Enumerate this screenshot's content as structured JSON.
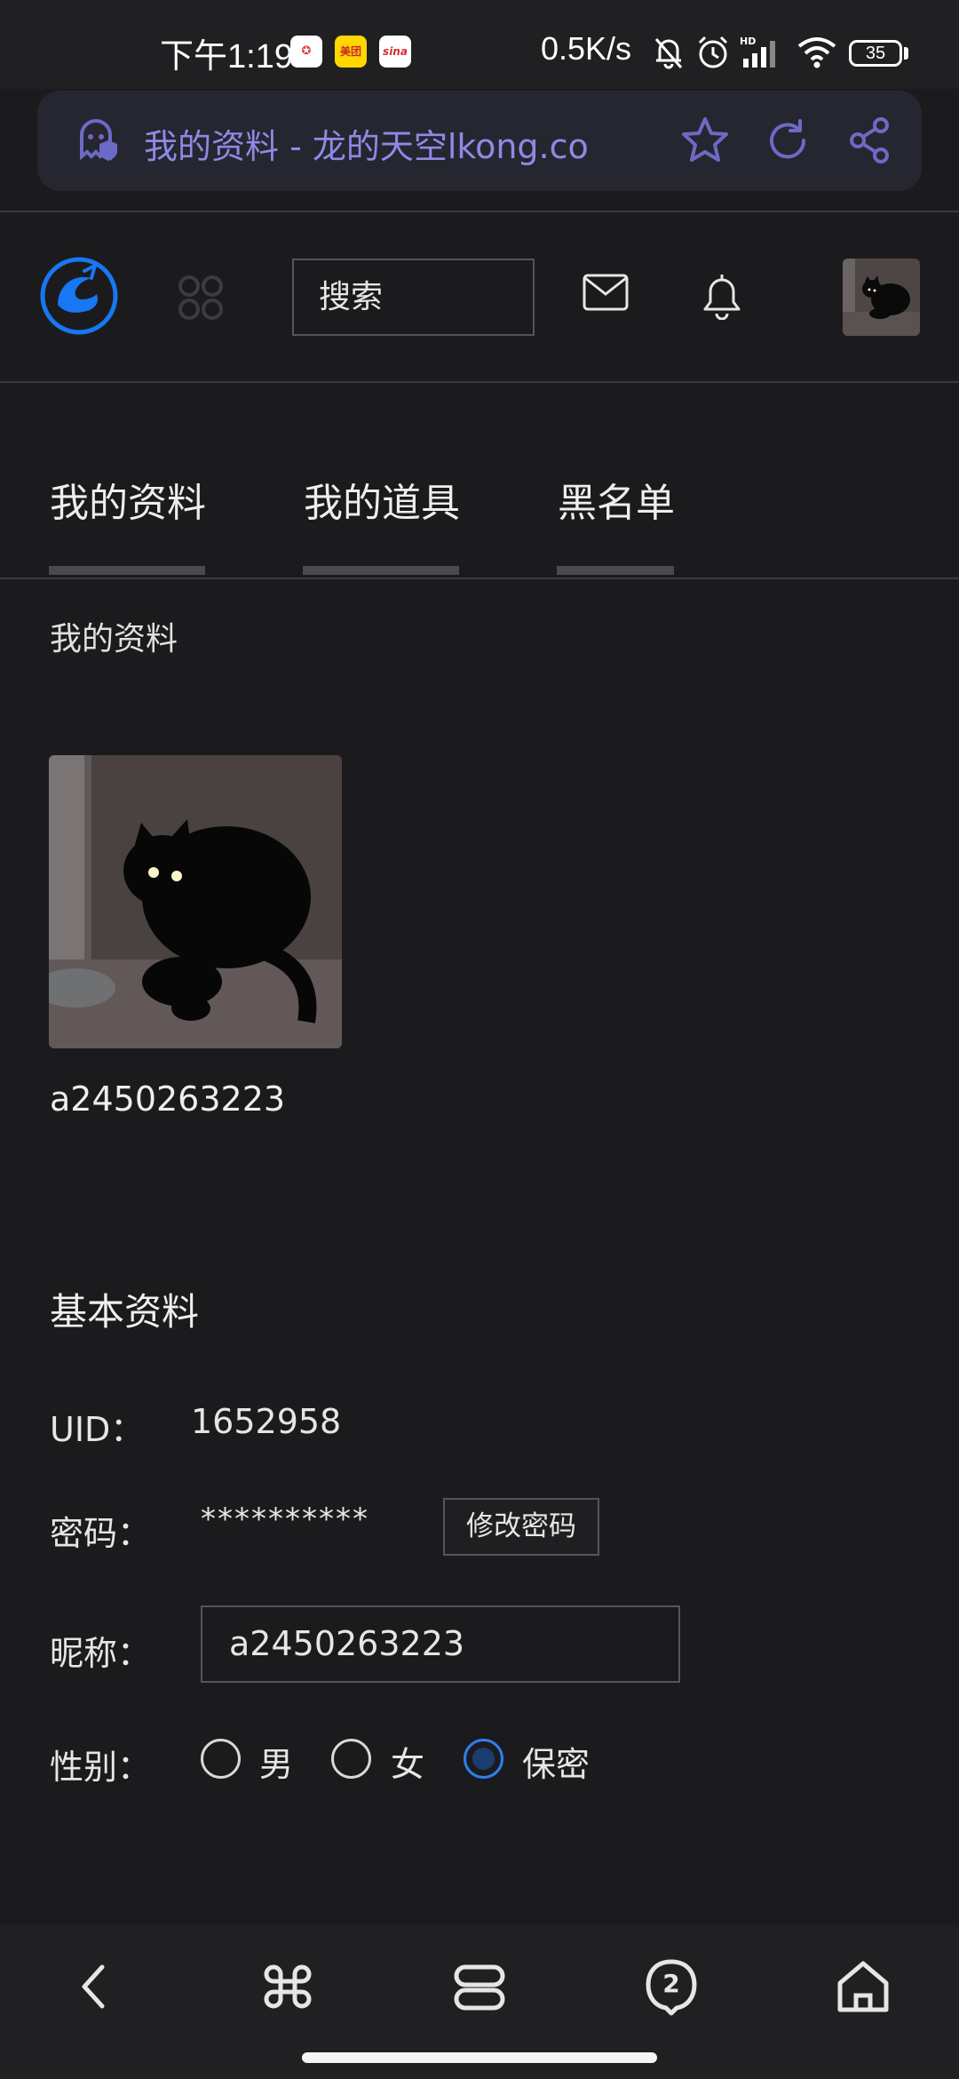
{
  "status_bar": {
    "time": "下午1:19",
    "app_badges": [
      "",
      "美团",
      "sina"
    ],
    "net_speed": "0.5K/s",
    "battery": "35"
  },
  "browser": {
    "url_text": "我的资料 - 龙的天空lkong.co"
  },
  "header": {
    "search_label": "搜索"
  },
  "tabs": [
    {
      "label": "我的资料"
    },
    {
      "label": "我的道具"
    },
    {
      "label": "黑名单"
    }
  ],
  "profile": {
    "section_label": "我的资料",
    "username": "a2450263223"
  },
  "basic_info": {
    "heading": "基本资料",
    "uid_label": "UID：",
    "uid_value": "1652958",
    "password_label": "密码：",
    "password_value": "**********",
    "change_password_label": "修改密码",
    "nickname_label": "昵称：",
    "nickname_value": "a2450263223",
    "gender_label": "性别：",
    "gender_options": [
      "男",
      "女",
      "保密"
    ],
    "gender_selected": "保密"
  },
  "bottom_nav": {
    "tabs_count": "2"
  },
  "colors": {
    "background": "#1b1b1d",
    "url_accent": "#8d8ae6",
    "logo_blue": "#1877f2",
    "radio_selected": "#2d7ff0"
  }
}
